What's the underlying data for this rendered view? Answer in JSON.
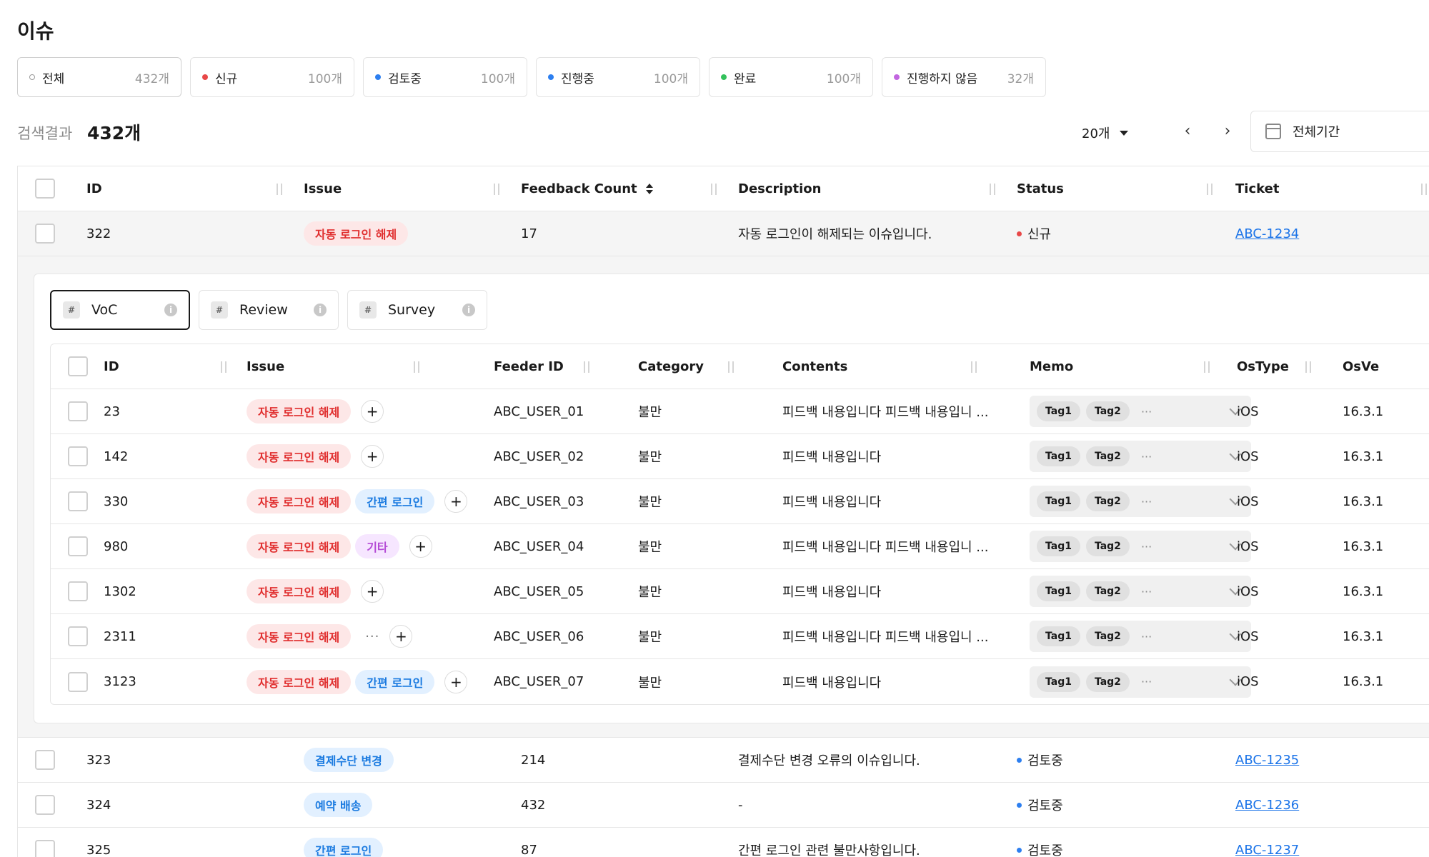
{
  "page": {
    "title": "이슈"
  },
  "filters": [
    {
      "label": "전체",
      "count": "432개",
      "color": ""
    },
    {
      "label": "신규",
      "count": "100개",
      "color": "#e84848"
    },
    {
      "label": "검토중",
      "count": "100개",
      "color": "#2d7ff0"
    },
    {
      "label": "진행중",
      "count": "100개",
      "color": "#2d7ff0"
    },
    {
      "label": "완료",
      "count": "100개",
      "color": "#33c15b"
    },
    {
      "label": "진행하지 않음",
      "count": "32개",
      "color": "#c266e0"
    }
  ],
  "results": {
    "label": "검색결과",
    "count": "432개",
    "page_size": "20개",
    "prev": "‹",
    "next": "›",
    "date_range": "전체기간"
  },
  "table": {
    "headers": {
      "id": "ID",
      "issue": "Issue",
      "feedback_count": "Feedback Count",
      "description": "Description",
      "status": "Status",
      "ticket": "Ticket"
    },
    "rows": [
      {
        "id": "322",
        "issue": "자동 로그인 해제",
        "issue_color": "red",
        "count": "17",
        "description": "자동 로그인이 해제되는 이슈입니다.",
        "status": "신규",
        "status_color": "#e84848",
        "ticket": "ABC-1234"
      },
      {
        "id": "323",
        "issue": "결제수단 변경",
        "issue_color": "blue",
        "count": "214",
        "description": "결제수단 변경 오류의 이슈입니다.",
        "status": "검토중",
        "status_color": "#2d7ff0",
        "ticket": "ABC-1235"
      },
      {
        "id": "324",
        "issue": "예약 배송",
        "issue_color": "blue",
        "count": "432",
        "description": "-",
        "status": "검토중",
        "status_color": "#2d7ff0",
        "ticket": "ABC-1236"
      },
      {
        "id": "325",
        "issue": "간편 로그인",
        "issue_color": "blue",
        "count": "87",
        "description": "간편 로그인 관련 불만사항입니다.",
        "status": "검토중",
        "status_color": "#2d7ff0",
        "ticket": "ABC-1237"
      }
    ]
  },
  "expanded": {
    "tabs": [
      {
        "label": "VoC",
        "hash": "#",
        "info": "i"
      },
      {
        "label": "Review",
        "hash": "#",
        "info": "i"
      },
      {
        "label": "Survey",
        "hash": "#",
        "info": "i"
      }
    ],
    "headers": {
      "id": "ID",
      "issue": "Issue",
      "feeder_id": "Feeder ID",
      "category": "Category",
      "contents": "Contents",
      "memo": "Memo",
      "ostype": "OsType",
      "osversion": "OsVe"
    },
    "plus": "+",
    "more": "···",
    "rows": [
      {
        "id": "23",
        "tags": [
          {
            "t": "자동 로그인 해제",
            "c": "red"
          }
        ],
        "extra": false,
        "feeder": "ABC_USER_01",
        "category": "불만",
        "contents": "피드백 내용입니다 피드백 내용입니 ...",
        "memo": [
          "Tag1",
          "Tag2"
        ],
        "os": "iOS",
        "osv": "16.3.1"
      },
      {
        "id": "142",
        "tags": [
          {
            "t": "자동 로그인 해제",
            "c": "red"
          }
        ],
        "extra": false,
        "feeder": "ABC_USER_02",
        "category": "불만",
        "contents": "피드백 내용입니다",
        "memo": [
          "Tag1",
          "Tag2"
        ],
        "os": "iOS",
        "osv": "16.3.1"
      },
      {
        "id": "330",
        "tags": [
          {
            "t": "자동 로그인 해제",
            "c": "red"
          },
          {
            "t": "간편 로그인",
            "c": "blue"
          }
        ],
        "extra": false,
        "feeder": "ABC_USER_03",
        "category": "불만",
        "contents": "피드백 내용입니다",
        "memo": [
          "Tag1",
          "Tag2"
        ],
        "os": "iOS",
        "osv": "16.3.1"
      },
      {
        "id": "980",
        "tags": [
          {
            "t": "자동 로그인 해제",
            "c": "red"
          },
          {
            "t": "기타",
            "c": "purple"
          }
        ],
        "extra": false,
        "feeder": "ABC_USER_04",
        "category": "불만",
        "contents": "피드백 내용입니다 피드백 내용입니 ...",
        "memo": [
          "Tag1",
          "Tag2"
        ],
        "os": "iOS",
        "osv": "16.3.1"
      },
      {
        "id": "1302",
        "tags": [
          {
            "t": "자동 로그인 해제",
            "c": "red"
          }
        ],
        "extra": false,
        "feeder": "ABC_USER_05",
        "category": "불만",
        "contents": "피드백 내용입니다",
        "memo": [
          "Tag1",
          "Tag2"
        ],
        "os": "iOS",
        "osv": "16.3.1"
      },
      {
        "id": "2311",
        "tags": [
          {
            "t": "자동 로그인 해제",
            "c": "red"
          }
        ],
        "extra": true,
        "feeder": "ABC_USER_06",
        "category": "불만",
        "contents": "피드백 내용입니다 피드백 내용입니 ...",
        "memo": [
          "Tag1",
          "Tag2"
        ],
        "os": "iOS",
        "osv": "16.3.1"
      },
      {
        "id": "3123",
        "tags": [
          {
            "t": "자동 로그인 해제",
            "c": "red"
          },
          {
            "t": "간편 로그인",
            "c": "blue"
          }
        ],
        "extra": false,
        "feeder": "ABC_USER_07",
        "category": "불만",
        "contents": "피드백 내용입니다",
        "memo": [
          "Tag1",
          "Tag2"
        ],
        "os": "iOS",
        "osv": "16.3.1"
      }
    ]
  }
}
